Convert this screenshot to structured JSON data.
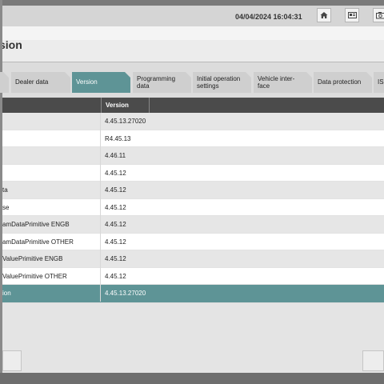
{
  "header": {
    "datetime": "04/04/2024 16:04:31",
    "buttons": [
      {
        "icon": "home-icon"
      },
      {
        "icon": "id-card-icon"
      },
      {
        "icon": "camera-icon"
      }
    ]
  },
  "page_title_fragment": "sion",
  "tabs": [
    {
      "label": "",
      "selected": false
    },
    {
      "label": "Dealer data",
      "selected": false
    },
    {
      "label": "Version",
      "selected": true
    },
    {
      "label": "Programming data",
      "line1": "Programming",
      "line2": "data",
      "selected": false
    },
    {
      "label": "Initial operation settings",
      "line1": "Initial operation",
      "line2": "settings",
      "selected": false
    },
    {
      "label": "Vehicle interface",
      "line1": "Vehicle inter-",
      "line2": "face",
      "selected": false
    },
    {
      "label": "Data protection",
      "selected": false
    },
    {
      "label": "IS",
      "selected": false
    }
  ],
  "table": {
    "columns": [
      "",
      "Version"
    ],
    "rows": [
      {
        "name": "",
        "version": "4.45.13.27020"
      },
      {
        "name": "",
        "version": "R4.45.13"
      },
      {
        "name": "",
        "version": "4.46.11"
      },
      {
        "name": "",
        "version": "4.45.12"
      },
      {
        "name": "ta",
        "version": "4.45.12"
      },
      {
        "name": "se",
        "version": "4.45.12"
      },
      {
        "name": "amDataPrimitive ENGB",
        "version": "4.45.12"
      },
      {
        "name": "amDataPrimitive OTHER",
        "version": "4.45.12"
      },
      {
        "name": "ValuePrimitive ENGB",
        "version": "4.45.12"
      },
      {
        "name": "ValuePrimitive OTHER",
        "version": "4.45.12"
      },
      {
        "name": "ion",
        "version": "4.45.13.27020"
      }
    ],
    "selected_row_index": 10
  },
  "colors": {
    "accent": "#5e9496",
    "header_bg": "#d5d5d5",
    "table_header_bg": "#4b4b4b"
  }
}
